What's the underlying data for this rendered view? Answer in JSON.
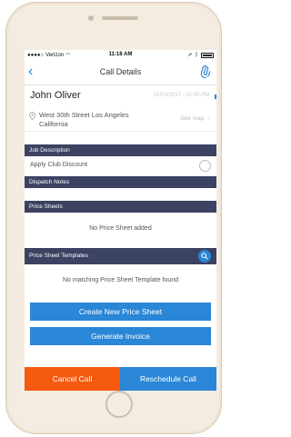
{
  "status_bar": {
    "carrier": "Verizon",
    "time": "11:18 AM"
  },
  "nav": {
    "title": "Call Details",
    "back_icon": "chevron-left-icon",
    "attach_icon": "paperclip-icon"
  },
  "customer": {
    "name": "John Oliver",
    "datetime": "01/03/2017 - 01:00 PM"
  },
  "address": {
    "line1": "West 30th Street Los Angeles",
    "line2": "California",
    "see_map_label": "See map"
  },
  "sections": {
    "job_description": "Job Description",
    "apply_club_discount": "Apply Club Discount",
    "dispatch_notes": "Dispatch Notes",
    "price_sheets": "Price Sheets",
    "no_price_sheet": "No Price Sheet added",
    "price_sheet_templates": "Price Sheet Templates",
    "no_template": "No matching Price Sheet Template found"
  },
  "buttons": {
    "create_price_sheet": "Create New Price Sheet",
    "generate_invoice": "Generate Invoice",
    "cancel_call": "Cancel Call",
    "reschedule_call": "Reschedule Call"
  },
  "colors": {
    "accent_blue": "#2a86d6",
    "section_header": "#3b4262",
    "cancel_orange": "#f45a0f"
  }
}
